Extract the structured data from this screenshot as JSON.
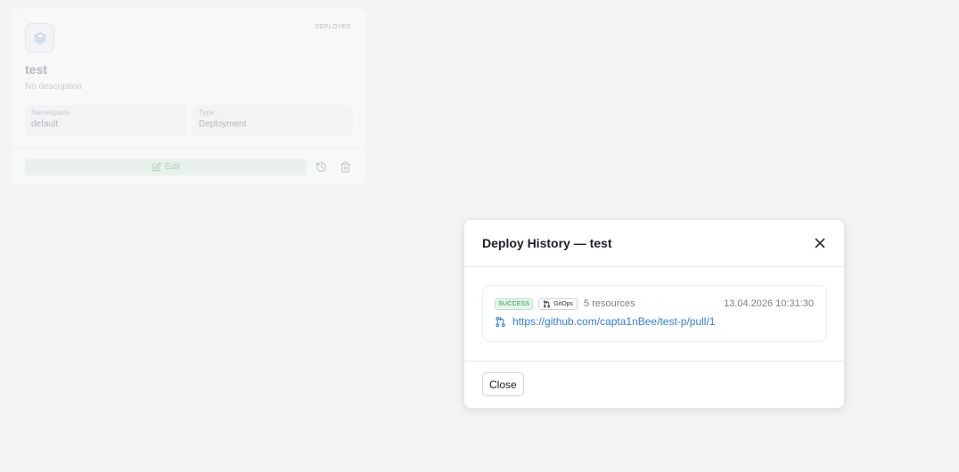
{
  "card": {
    "icon": "layers-icon",
    "status": "DEPLOYED",
    "title": "test",
    "description": "No description",
    "namespace_label": "Namespace",
    "namespace_value": "default",
    "type_label": "Type",
    "type_value": "Deployment",
    "edit_label": "Edit",
    "colors": {
      "edit_bg": "#e9f1ec",
      "edit_text": "#a7d7b7"
    }
  },
  "modal": {
    "title": "Deploy History — test",
    "entry": {
      "status": "SUCCESS",
      "source": "GitOps",
      "resources": "5 resources",
      "timestamp": "13.04.2026 10:31:30",
      "link": "https://github.com/capta1nBee/test-p/pull/1"
    },
    "close_label": "Close",
    "colors": {
      "success": "#1a9a55",
      "link": "#2f7de1"
    }
  }
}
